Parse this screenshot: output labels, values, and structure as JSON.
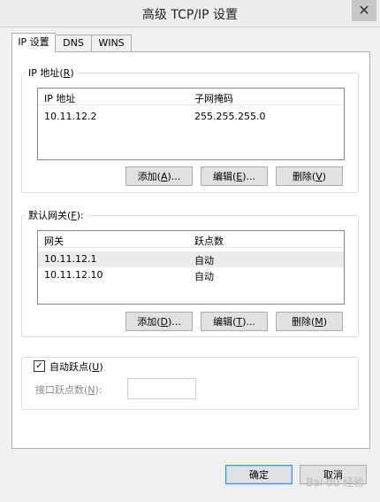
{
  "window": {
    "title": "高级 TCP/IP 设置",
    "close_glyph": "✕"
  },
  "tabs": [
    {
      "label": "IP 设置"
    },
    {
      "label": "DNS"
    },
    {
      "label": "WINS"
    }
  ],
  "ip_group": {
    "legend": "IP 地址",
    "accel": "R",
    "columns": [
      "IP 地址",
      "子网掩码"
    ],
    "rows": [
      {
        "ip": "10.11.12.2",
        "mask": "255.255.255.0"
      }
    ],
    "buttons": [
      {
        "label": "添加(",
        "accel": "A",
        "suffix": ")..."
      },
      {
        "label": "编辑(",
        "accel": "E",
        "suffix": ")..."
      },
      {
        "label": "删除(",
        "accel": "V",
        "suffix": ")"
      }
    ]
  },
  "gateway_group": {
    "legend": "默认网关",
    "accel": "F",
    "suffix": ":",
    "columns": [
      "网关",
      "跃点数"
    ],
    "rows": [
      {
        "gateway": "10.11.12.1",
        "metric": "自动"
      },
      {
        "gateway": "10.11.12.10",
        "metric": "自动"
      }
    ],
    "buttons": [
      {
        "label": "添加(",
        "accel": "D",
        "suffix": ")..."
      },
      {
        "label": "编辑(",
        "accel": "T",
        "suffix": ")..."
      },
      {
        "label": "删除(",
        "accel": "M",
        "suffix": ")"
      }
    ]
  },
  "metric": {
    "checkbox_label": "自动跃点(",
    "checkbox_accel": "U",
    "checkbox_suffix": ")",
    "checkbox_checked": "✓",
    "interface_label": "接口跃点数(",
    "interface_accel": "N",
    "interface_suffix": "):",
    "interface_value": ""
  },
  "footer": {
    "ok": "确定",
    "cancel": "取消"
  },
  "watermark": "Bai du 经验"
}
